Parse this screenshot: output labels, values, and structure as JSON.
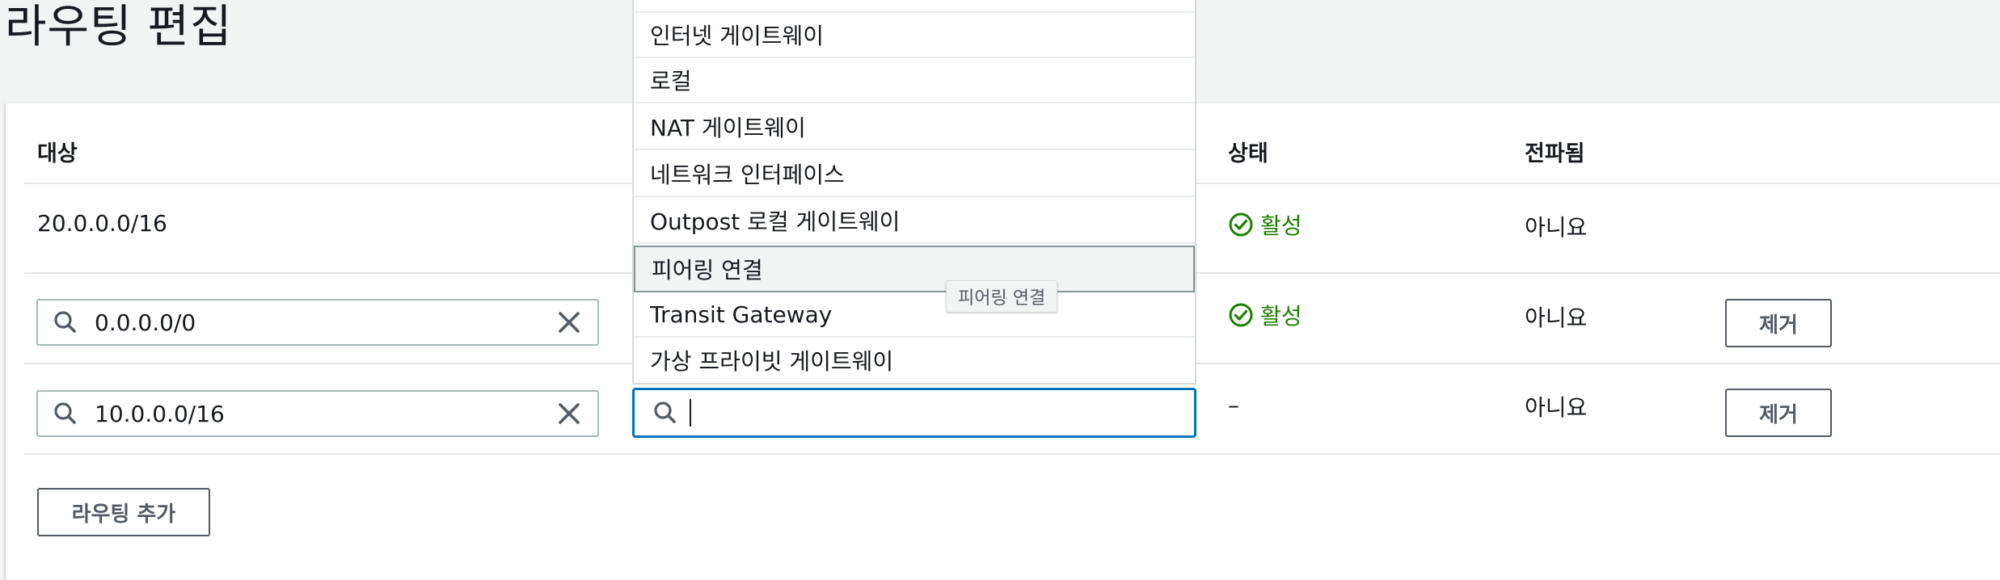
{
  "page": {
    "title": "라우팅 편집"
  },
  "table": {
    "headers": {
      "destination": "대상",
      "status": "상태",
      "propagated": "전파됨"
    },
    "rows": [
      {
        "destination": "20.0.0.0/16",
        "status": "활성",
        "propagated": "아니요"
      },
      {
        "destination": "0.0.0.0/0",
        "status": "활성",
        "propagated": "아니요",
        "remove_label": "제거"
      },
      {
        "destination": "10.0.0.0/16",
        "status": "–",
        "propagated": "아니요",
        "remove_label": "제거"
      }
    ]
  },
  "dropdown": {
    "items": [
      "인터넷 게이트웨이",
      "로컬",
      "NAT 게이트웨이",
      "네트워크 인터페이스",
      "Outpost 로컬 게이트웨이",
      "피어링 연결",
      "Transit Gateway",
      "가상 프라이빗 게이트웨이"
    ],
    "highlighted_index": 5,
    "tooltip": "피어링 연결",
    "filter_value": ""
  },
  "actions": {
    "add_route_label": "라우팅 추가"
  },
  "colors": {
    "active": "#1d8102",
    "focus": "#0073bb"
  },
  "icons": [
    "search-icon",
    "clear-icon",
    "status-success-icon"
  ]
}
